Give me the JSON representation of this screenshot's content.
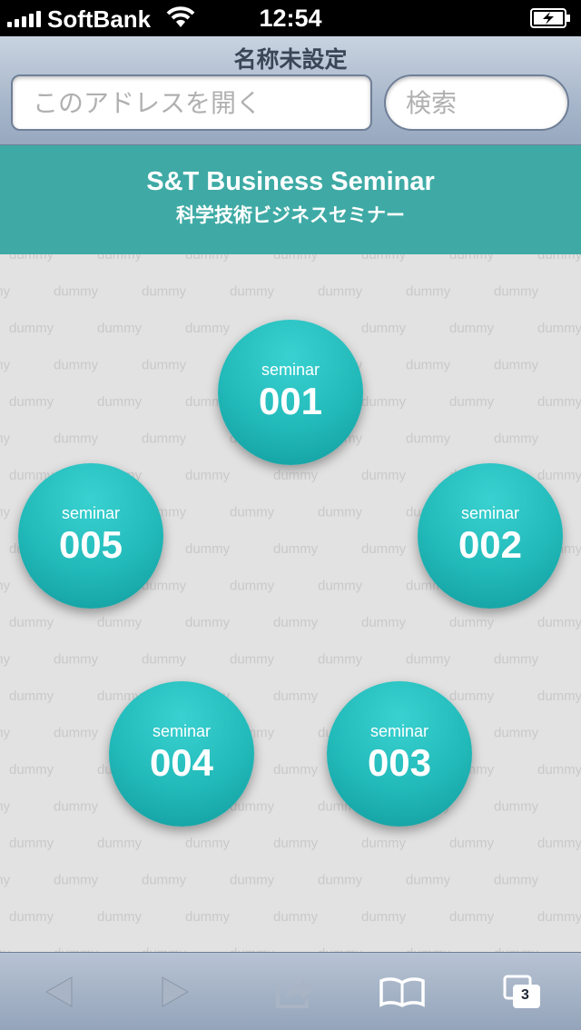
{
  "status_bar": {
    "carrier": "SoftBank",
    "time": "12:54",
    "signal_bars": 5,
    "wifi_icon": "wifi-icon",
    "battery_icon": "battery-charging-icon"
  },
  "browser": {
    "page_title": "名称未設定",
    "address_placeholder": "このアドレスを開く",
    "search_placeholder": "検索"
  },
  "banner": {
    "title": "S&T Business Seminar",
    "subtitle": "科学技術ビジネスセミナー",
    "color": "#3faaa5"
  },
  "background_watermark": "dummy",
  "seminars": [
    {
      "label": "seminar",
      "number": "001"
    },
    {
      "label": "seminar",
      "number": "002"
    },
    {
      "label": "seminar",
      "number": "003"
    },
    {
      "label": "seminar",
      "number": "004"
    },
    {
      "label": "seminar",
      "number": "005"
    }
  ],
  "toolbar": {
    "back_icon": "back-arrow-icon",
    "forward_icon": "forward-arrow-icon",
    "share_icon": "share-icon",
    "bookmarks_icon": "bookmarks-icon",
    "tabs_icon": "tabs-icon",
    "tabs_count": "3"
  },
  "colors": {
    "accent": "#22b9b9",
    "page_background": "#e2e2e2"
  }
}
